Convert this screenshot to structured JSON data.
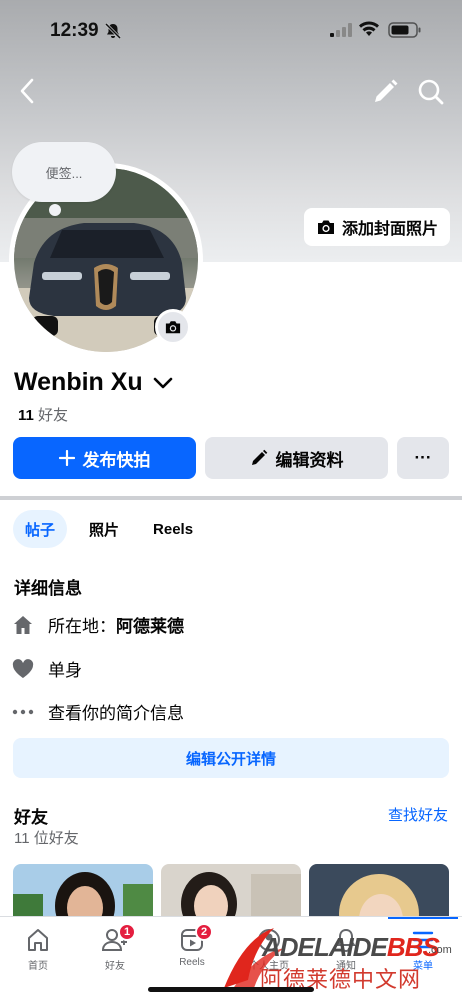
{
  "status_bar": {
    "time": "12:39"
  },
  "profile": {
    "note_placeholder": "便签...",
    "add_cover_label": "添加封面照片",
    "name": "Wenbin Xu",
    "friends_count": "11",
    "friends_label": "好友"
  },
  "actions": {
    "publish_story": "发布快拍",
    "edit_profile": "编辑资料",
    "more": "···"
  },
  "tabs": [
    {
      "label": "帖子",
      "active": true
    },
    {
      "label": "照片",
      "active": false
    },
    {
      "label": "Reels",
      "active": false
    }
  ],
  "details": {
    "title": "详细信息",
    "location_prefix": "所在地：",
    "location": "阿德莱德",
    "relationship": "单身",
    "view_intro": "查看你的简介信息",
    "edit_public": "编辑公开详情"
  },
  "friends_section": {
    "title": "好友",
    "count_text": "11 位好友",
    "find": "查找好友"
  },
  "bottom_nav": [
    {
      "label": "首页",
      "icon": "home-icon",
      "badge": ""
    },
    {
      "label": "好友",
      "icon": "friends-icon",
      "badge": "1"
    },
    {
      "label": "Reels",
      "icon": "reels-icon",
      "badge": "2"
    },
    {
      "label": "个人主页",
      "icon": "profile-icon",
      "badge": ""
    },
    {
      "label": "通知",
      "icon": "bell-icon",
      "badge": ""
    },
    {
      "label": "菜单",
      "icon": "menu-icon",
      "badge": ""
    }
  ],
  "watermark": {
    "brand_a": "ADELAIDE",
    "brand_b": "BBS",
    "domain": ".com",
    "subtitle": "阿德莱德中文网"
  },
  "colors": {
    "accent": "#0866ff",
    "badge": "#e41e3f",
    "secondary_text": "#65676b"
  }
}
